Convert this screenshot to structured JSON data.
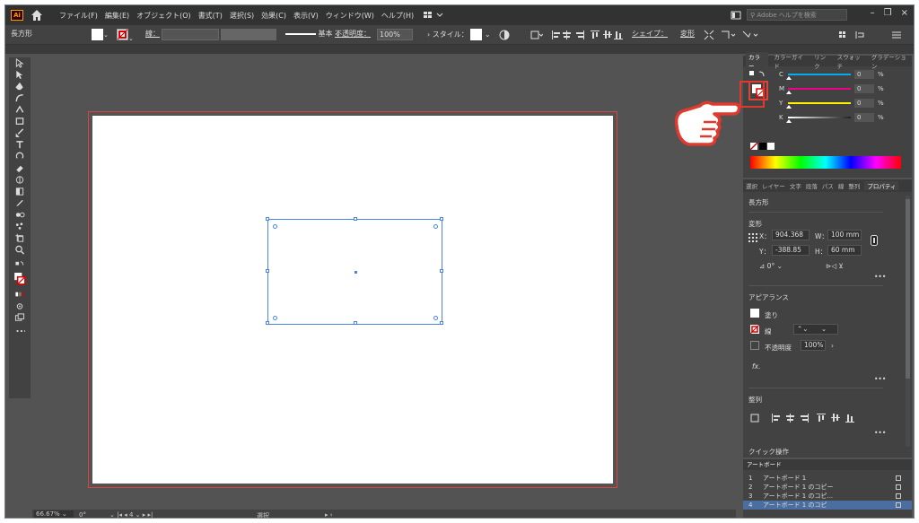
{
  "app": {
    "logo_text": "Ai"
  },
  "menu": {
    "items": [
      "ファイル(F)",
      "編集(E)",
      "オブジェクト(O)",
      "書式(T)",
      "選択(S)",
      "効果(C)",
      "表示(V)",
      "ウィンドウ(W)",
      "ヘルプ(H)"
    ]
  },
  "search": {
    "placeholder": "Adobe ヘルプを検索"
  },
  "window_controls": {
    "minimize": "–",
    "restore": "❐",
    "close": "×"
  },
  "control_bar": {
    "object_type": "長方形",
    "stroke_label": "線：",
    "stroke_style": "基本",
    "opacity_label": "不透明度：",
    "opacity_value": "100%",
    "style_label": "スタイル：",
    "shape_label": "シェイプ：",
    "transform_label": "変形"
  },
  "color_panel": {
    "tabs": [
      "カラー",
      "カラーガイド",
      "リンク",
      "スウォッチ",
      "グラデーション"
    ],
    "channels": [
      {
        "letter": "C",
        "value": "0",
        "unit": "%",
        "color": "#00aeef"
      },
      {
        "letter": "M",
        "value": "0",
        "unit": "%",
        "color": "#ec008c"
      },
      {
        "letter": "Y",
        "value": "0",
        "unit": "%",
        "color": "#fff200"
      },
      {
        "letter": "K",
        "value": "0",
        "unit": "%",
        "color": "#231f20"
      }
    ]
  },
  "properties": {
    "tabs": [
      "選択",
      "レイヤー",
      "文字",
      "段落",
      "パス",
      "線",
      "整列",
      "プロパティ"
    ],
    "object_name": "長方形",
    "transform_heading": "変形",
    "x_label": "X：",
    "x_value": "904.368",
    "y_label": "Y：",
    "y_value": "-388.85",
    "w_label": "W：",
    "w_value": "100 mm",
    "h_label": "H：",
    "h_value": "60 mm",
    "angle_value": "0°",
    "appearance_heading": "アピアランス",
    "fill_label": "塗り",
    "stroke_label": "線",
    "opacity_label": "不透明度",
    "opacity_value": "100%",
    "fx_label": "fx.",
    "align_heading": "整列",
    "quick_actions_heading": "クイック操作",
    "more": "•••"
  },
  "artboards_panel": {
    "title": "アートボード",
    "rows": [
      {
        "num": "1",
        "name": "アートボード 1"
      },
      {
        "num": "2",
        "name": "アートボード 1 のコピー"
      },
      {
        "num": "3",
        "name": "アートボード 1 のコピ..."
      },
      {
        "num": "4",
        "name": "アートボード 1 のコピ"
      }
    ]
  },
  "status": {
    "zoom": "66.67%",
    "rotation": "0°",
    "artboard_index": "4",
    "mode": "選択"
  },
  "colors": {
    "accent_red": "#d9453a",
    "selection_blue": "#4a84e0"
  }
}
